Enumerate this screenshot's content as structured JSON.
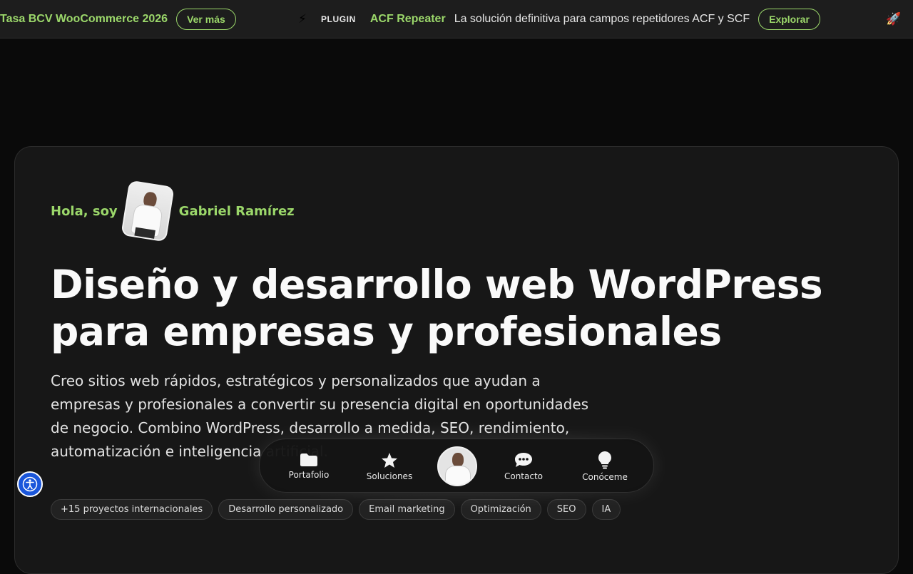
{
  "ticker": {
    "left_title": "Tasa BCV WooCommerce 2026",
    "left_button": "Ver más",
    "bolt_icon": "⚡",
    "tag": "PLUGIN",
    "title": "ACF Repeater",
    "description": "La solución definitiva para campos repetidores ACF y SCF",
    "button": "Explorar",
    "rocket_icon": "🚀"
  },
  "hero": {
    "hello_prefix": "Hola, soy",
    "name": "Gabriel Ramírez",
    "headline_line1": "Diseño y desarrollo web WordPress",
    "headline_line2": "para empresas y profesionales",
    "lead": "Creo sitios web rápidos, estratégicos y personalizados que ayudan a empresas y profesionales a convertir su presencia digital en oportunidades de negocio. Combino WordPress, desarrollo a medida, SEO, rendimiento, automatización e inteligencia artificial.",
    "chips": [
      "+15 proyectos internacionales",
      "Desarrollo personalizado",
      "Email marketing",
      "Optimización",
      "SEO",
      "IA"
    ]
  },
  "dock": {
    "items": [
      {
        "label": "Portafolio",
        "icon": "folder-icon"
      },
      {
        "label": "Soluciones",
        "icon": "star-icon"
      },
      {
        "label": "Contacto",
        "icon": "chat-icon"
      },
      {
        "label": "Conóceme",
        "icon": "lightbulb-icon"
      }
    ]
  },
  "accessibility": {
    "icon": "accessibility-icon"
  },
  "colors": {
    "accent": "#9bd76a",
    "background": "#0a0a0a",
    "card": "#171717",
    "a11y_blue": "#1a56db"
  }
}
